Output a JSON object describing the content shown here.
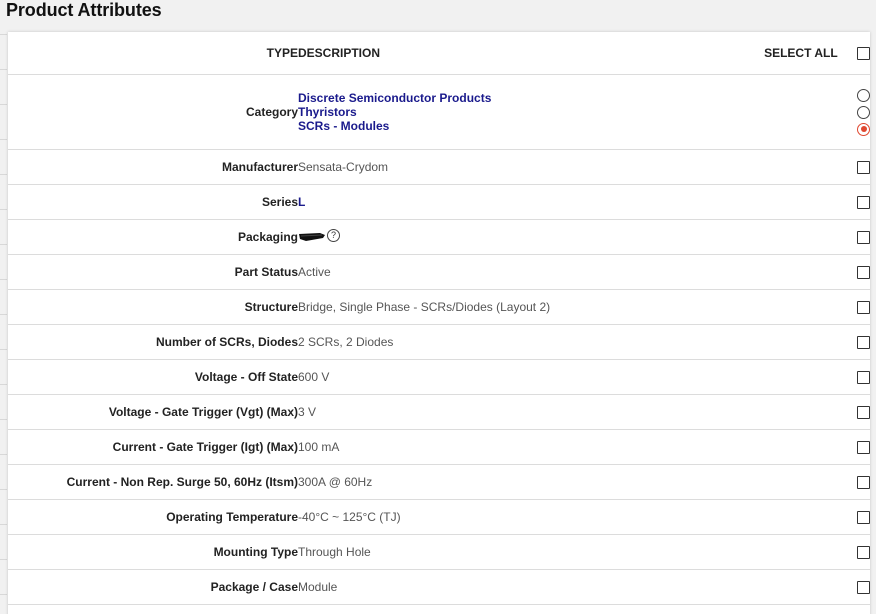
{
  "page": {
    "title": "Product Attributes"
  },
  "table": {
    "headers": {
      "type": "TYPE",
      "description": "DESCRIPTION",
      "select_all": "SELECT ALL"
    },
    "category": {
      "type": "Category",
      "options": [
        {
          "label": "Discrete Semiconductor Products",
          "selected": false
        },
        {
          "label": "Thyristors",
          "selected": false
        },
        {
          "label": "SCRs - Modules",
          "selected": true
        }
      ]
    },
    "rows": [
      {
        "type": "Manufacturer",
        "value": "Sensata-Crydom",
        "link": false
      },
      {
        "type": "Series",
        "value": "L",
        "link": true
      },
      {
        "type": "Packaging",
        "value": "",
        "link": false,
        "icon": "redacted-mark-icon",
        "help": "?"
      },
      {
        "type": "Part Status",
        "value": "Active",
        "link": false
      },
      {
        "type": "Structure",
        "value": "Bridge, Single Phase - SCRs/Diodes (Layout 2)",
        "link": false
      },
      {
        "type": "Number of SCRs, Diodes",
        "value": "2 SCRs, 2 Diodes",
        "link": false
      },
      {
        "type": "Voltage - Off State",
        "value": "600 V",
        "link": false
      },
      {
        "type": "Voltage - Gate Trigger (Vgt) (Max)",
        "value": "3 V",
        "link": false
      },
      {
        "type": "Current - Gate Trigger (Igt) (Max)",
        "value": "100 mA",
        "link": false
      },
      {
        "type": "Current - Non Rep. Surge 50, 60Hz (Itsm)",
        "value": "300A @ 60Hz",
        "link": false
      },
      {
        "type": "Operating Temperature",
        "value": "-40°C ~ 125°C (TJ)",
        "link": false
      },
      {
        "type": "Mounting Type",
        "value": "Through Hole",
        "link": false
      },
      {
        "type": "Package / Case",
        "value": "Module",
        "link": false
      }
    ]
  },
  "colors": {
    "link": "#1a1a8c",
    "radio_selected": "#e04830"
  }
}
